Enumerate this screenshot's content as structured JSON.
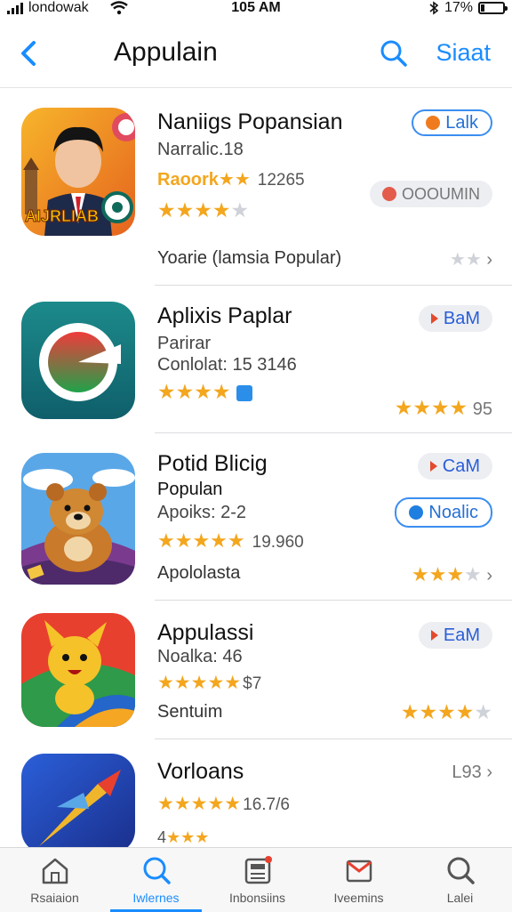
{
  "status_bar": {
    "carrier": "londowak",
    "time": "105 AM",
    "battery": "17%",
    "battery_level": 0.17
  },
  "nav": {
    "title": "Appulain",
    "action_label": "Siaat"
  },
  "apps": [
    {
      "name": "Naniigs Popansian",
      "subtitle": "Narralic.18",
      "rating_label": "Raoork",
      "rating_count": "12265",
      "stars": 4,
      "footer": "Yoarie (lamsia Popular)",
      "chip1": "Lalk",
      "chip2": "OOOUMIN",
      "icon_text": "AIJRLIAB"
    },
    {
      "name": "Aplixis Paplar",
      "subtitle": "Parirar",
      "detail": "Conlolat: 15 3146",
      "stars": 4,
      "chip1": "BaM",
      "side_value": "95"
    },
    {
      "name": "Potid Blicig",
      "subtitle": "Populan",
      "detail": "Apoiks: 2-2",
      "stars": 5,
      "rating_count": "19.960",
      "footer": "Apololasta",
      "chip1": "CaM",
      "chip2": "Noalic"
    },
    {
      "name": "Appulassi",
      "detail": "Noalka: 46",
      "stars": 5,
      "star_tail": "$7",
      "footer": "Sentuim",
      "chip1": "EaM"
    },
    {
      "name": "Vorloans",
      "stars": 5,
      "rating_count": "16.7/6",
      "side_value": "L93",
      "footer_partial": "4"
    }
  ],
  "tabs": [
    {
      "label": "Rsaiaion",
      "icon": "home-icon"
    },
    {
      "label": "Iwlernes",
      "icon": "search-icon",
      "active": true
    },
    {
      "label": "Inbonsiins",
      "icon": "news-icon"
    },
    {
      "label": "Iveemins",
      "icon": "inbox-icon"
    },
    {
      "label": "Lalei",
      "icon": "search-icon"
    }
  ]
}
